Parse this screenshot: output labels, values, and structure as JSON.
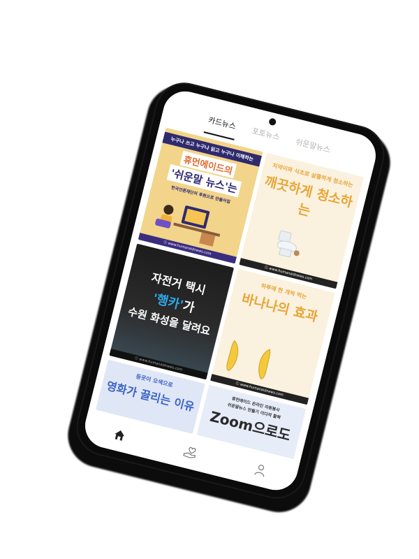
{
  "tabs": [
    {
      "label": "카드뉴스",
      "active": true
    },
    {
      "label": "포토뉴스",
      "active": false
    },
    {
      "label": "쉬운말뉴스",
      "active": false
    }
  ],
  "cards": {
    "c1": {
      "band": "누구나 쓰고 누구나 읽고 누구나 이해하는",
      "title1": "휴먼에이드의",
      "title2": "'쉬운말 뉴스'는",
      "sub": "한국언론재단의 후원으로 만들어짐",
      "footer": "ⓒ www.humanaidnews.com"
    },
    "c2": {
      "title1": "치약이와 식초로 살뜰하게 청소하는",
      "title2": "깨끗하게 청소하는",
      "footer": "ⓒ www.humanaidnews.com"
    },
    "c3": {
      "title1": "자전거 택시",
      "title2a": "'행카'",
      "title2b": "가",
      "title3": "수원 화성을 달려요",
      "footer": "ⓒ www.humanaidnews.com"
    },
    "c4": {
      "title1": "하루에 한 개씩 먹는",
      "title2": "바나나의 효과",
      "footer": "ⓒ www.humanaidnews.com"
    },
    "c5": {
      "title1": "등굣이 오색으로",
      "title2": "영화가 끌리는 이유"
    },
    "c6": {
      "line1": "휴먼에이드 온라인 자원봉사",
      "line2": "쉬운말뉴스 만들기 이다까 활짝",
      "title": "Zoom으로도"
    }
  },
  "nav": [
    {
      "icon": "home-icon",
      "active": true
    },
    {
      "icon": "heart-hand-icon",
      "active": false
    },
    {
      "icon": "user-icon",
      "active": false
    }
  ],
  "colors": {
    "accent_orange": "#e26a2c",
    "accent_navy": "#2f2a6e",
    "accent_yellow": "#e7a636",
    "accent_blue": "#2ea8e8"
  }
}
